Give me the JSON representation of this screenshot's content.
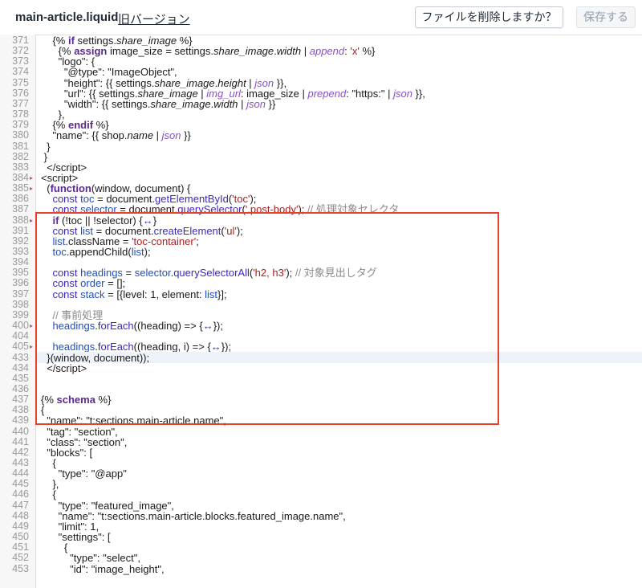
{
  "header": {
    "filename": "main-article.liquid",
    "old_version_link": "旧バージョン",
    "delete_button": "ファイルを削除しますか？",
    "save_button": "保存する"
  },
  "editor": {
    "lines": [
      {
        "n": "371",
        "html": "    {% <span class=\"k\">if</span> settings.<span class=\"i\">share_image</span> %}"
      },
      {
        "n": "372",
        "html": "      {% <span class=\"k\">assign</span> image_size = settings.<span class=\"i\">share_image</span>.<span class=\"i\">width</span> | <span class=\"p\">append</span>: <span class=\"s\">'x'</span> %}"
      },
      {
        "n": "373",
        "html": "      \"logo\": {"
      },
      {
        "n": "374",
        "html": "        \"@type\": \"ImageObject\","
      },
      {
        "n": "375",
        "html": "        \"height\": {{ settings.<span class=\"i\">share_image</span>.<span class=\"i\">height</span> | <span class=\"p\">json</span> }},"
      },
      {
        "n": "376",
        "html": "        \"url\": {{ settings.<span class=\"i\">share_image</span> | <span class=\"p\">img_url</span>: image_size | <span class=\"p\">prepend</span>: \"https:\" | <span class=\"p\">json</span> }},"
      },
      {
        "n": "377",
        "html": "        \"width\": {{ settings.<span class=\"i\">share_image</span>.<span class=\"i\">width</span> | <span class=\"p\">json</span> }}"
      },
      {
        "n": "378",
        "html": "      },"
      },
      {
        "n": "379",
        "html": "    {% <span class=\"k\">endif</span> %}"
      },
      {
        "n": "380",
        "html": "    \"name\": {{ shop.<span class=\"i\">name</span> | <span class=\"p\">json</span> }}"
      },
      {
        "n": "381",
        "html": "  }"
      },
      {
        "n": "382",
        "html": " }"
      },
      {
        "n": "383",
        "html": "  &lt;/script&gt;"
      },
      {
        "n": "384",
        "html": "&lt;script&gt;",
        "fold": true
      },
      {
        "n": "385",
        "html": "  (<span class=\"k\">function</span>(window, document) {",
        "fold": true
      },
      {
        "n": "386",
        "html": "    <span class=\"f\">const</span> <span class=\"v\">toc</span> = document.<span class=\"f\">getElementById</span>(<span class=\"s\">'toc'</span>);"
      },
      {
        "n": "387",
        "html": "    <span class=\"f\">const</span> <span class=\"v\">selector</span> = document.<span class=\"f\">querySelector</span>(<span class=\"s\">'.post-body'</span>); <span class=\"c\">// 処理対象セレクタ</span>"
      },
      {
        "n": "388",
        "html": "    <span class=\"k\">if</span> (!toc || !selector) {<span class=\"fold-mark\">↔</span>}",
        "fold": true
      },
      {
        "n": "391",
        "html": "    <span class=\"f\">const</span> <span class=\"v\">list</span> = document.<span class=\"f\">createElement</span>(<span class=\"s\">'ul'</span>);"
      },
      {
        "n": "392",
        "html": "    <span class=\"v\">list</span>.className = <span class=\"s\">'toc-container'</span>;"
      },
      {
        "n": "393",
        "html": "    <span class=\"v\">toc</span>.appendChild(<span class=\"v\">list</span>);"
      },
      {
        "n": "394",
        "html": ""
      },
      {
        "n": "395",
        "html": "    <span class=\"f\">const</span> <span class=\"v\">headings</span> = <span class=\"v\">selector</span>.<span class=\"f\">querySelectorAll</span>(<span class=\"s\">'h2, h3'</span>); <span class=\"c\">// 対象見出しタグ</span>"
      },
      {
        "n": "396",
        "html": "    <span class=\"f\">const</span> <span class=\"v\">order</span> = [];"
      },
      {
        "n": "397",
        "html": "    <span class=\"f\">const</span> <span class=\"v\">stack</span> = [{level: 1, element: <span class=\"v\">list</span>}];"
      },
      {
        "n": "398",
        "html": ""
      },
      {
        "n": "399",
        "html": "    <span class=\"c\">// 事前処理</span>"
      },
      {
        "n": "400",
        "html": "    <span class=\"v\">headings</span>.<span class=\"f\">forEach</span>((heading) =&gt; {<span class=\"fold-mark\">↔</span>});",
        "fold": true
      },
      {
        "n": "404",
        "html": ""
      },
      {
        "n": "405",
        "html": "    <span class=\"v\">headings</span>.<span class=\"f\">forEach</span>((heading, i) =&gt; {<span class=\"fold-mark\">↔</span>});",
        "fold": true
      },
      {
        "n": "433",
        "html": "  }(window, document));",
        "active": true
      },
      {
        "n": "434",
        "html": "  &lt;/script&gt;"
      },
      {
        "n": "435",
        "html": ""
      },
      {
        "n": "436",
        "html": ""
      },
      {
        "n": "437",
        "html": "{% <span class=\"k\">schema</span> %}"
      },
      {
        "n": "438",
        "html": "{"
      },
      {
        "n": "439",
        "html": "  \"name\": \"t:sections.main-article.name\","
      },
      {
        "n": "440",
        "html": "  \"tag\": \"section\","
      },
      {
        "n": "441",
        "html": "  \"class\": \"section\","
      },
      {
        "n": "442",
        "html": "  \"blocks\": ["
      },
      {
        "n": "443",
        "html": "    {"
      },
      {
        "n": "444",
        "html": "      \"type\": \"@app\""
      },
      {
        "n": "445",
        "html": "    },"
      },
      {
        "n": "446",
        "html": "    {"
      },
      {
        "n": "447",
        "html": "      \"type\": \"featured_image\","
      },
      {
        "n": "448",
        "html": "      \"name\": \"t:sections.main-article.blocks.featured_image.name\","
      },
      {
        "n": "449",
        "html": "      \"limit\": 1,"
      },
      {
        "n": "450",
        "html": "      \"settings\": ["
      },
      {
        "n": "451",
        "html": "        {"
      },
      {
        "n": "452",
        "html": "          \"type\": \"select\","
      },
      {
        "n": "453",
        "html": "          \"id\": \"image_height\","
      }
    ]
  }
}
